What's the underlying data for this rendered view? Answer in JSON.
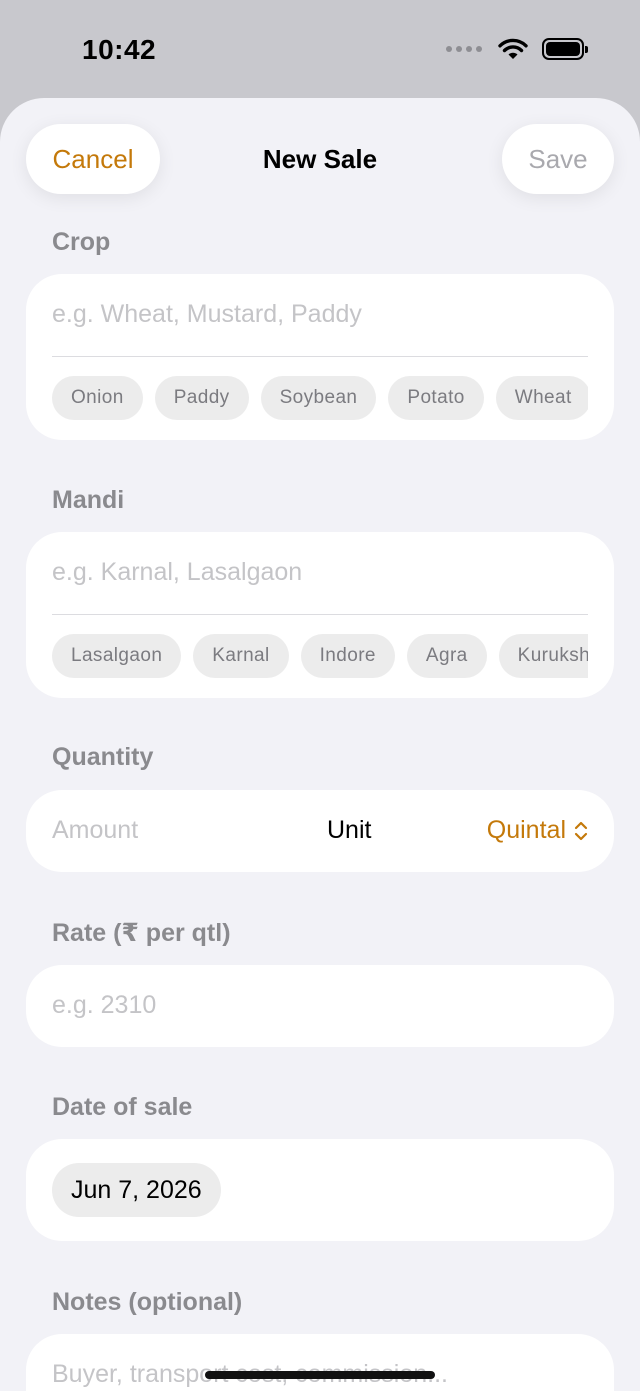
{
  "status": {
    "time": "10:42"
  },
  "nav": {
    "cancel": "Cancel",
    "title": "New Sale",
    "save": "Save"
  },
  "crop": {
    "label": "Crop",
    "placeholder": "e.g. Wheat, Mustard, Paddy",
    "chips": [
      "Onion",
      "Paddy",
      "Soybean",
      "Potato",
      "Wheat"
    ]
  },
  "mandi": {
    "label": "Mandi",
    "placeholder": "e.g. Karnal, Lasalgaon",
    "chips": [
      "Lasalgaon",
      "Karnal",
      "Indore",
      "Agra",
      "Kurukshetra"
    ]
  },
  "quantity": {
    "label": "Quantity",
    "placeholder": "Amount",
    "unit_label": "Unit",
    "unit_value": "Quintal"
  },
  "rate": {
    "label": "Rate (₹ per qtl)",
    "placeholder": "e.g. 2310"
  },
  "date": {
    "label": "Date of sale",
    "value": "Jun 7, 2026"
  },
  "notes": {
    "label": "Notes (optional)",
    "placeholder": "Buyer, transport cost, commission..."
  },
  "colors": {
    "accent": "#c4790a",
    "background": "#f2f2f7",
    "card": "#ffffff"
  }
}
